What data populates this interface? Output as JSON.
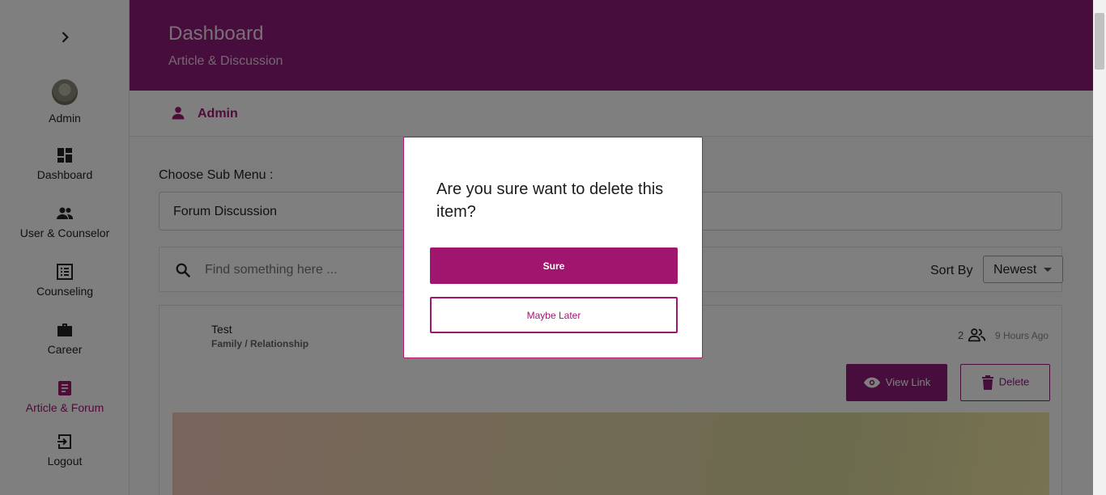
{
  "sidebar": {
    "toggle_icon": "chevron-right-icon",
    "user_label": "Admin",
    "items": [
      {
        "label": "Dashboard",
        "icon": "dashboard-icon"
      },
      {
        "label": "User & Counselor",
        "icon": "people-icon"
      },
      {
        "label": "Counseling",
        "icon": "list-icon"
      },
      {
        "label": "Career",
        "icon": "briefcase-icon"
      },
      {
        "label": "Article & Forum",
        "icon": "article-icon",
        "active": true
      },
      {
        "label": "Logout",
        "icon": "logout-icon"
      }
    ]
  },
  "header": {
    "title": "Dashboard",
    "subtitle": "Article & Discussion"
  },
  "userbar": {
    "name": "Admin"
  },
  "submenu": {
    "label": "Choose Sub Menu :",
    "selected": "Forum Discussion"
  },
  "search": {
    "placeholder": "Find something here ...",
    "sort_label": "Sort By",
    "sort_selected": "Newest"
  },
  "post": {
    "title": "Test",
    "category": "Family / Relationship",
    "participants": "2",
    "time": "9 Hours Ago",
    "view_label": "View Link",
    "delete_label": "Delete"
  },
  "modal": {
    "question": "Are you sure want to delete this item?",
    "confirm_label": "Sure",
    "cancel_label": "Maybe Later"
  },
  "colors": {
    "brand": "#8e1b79",
    "accent": "#a0166f"
  }
}
